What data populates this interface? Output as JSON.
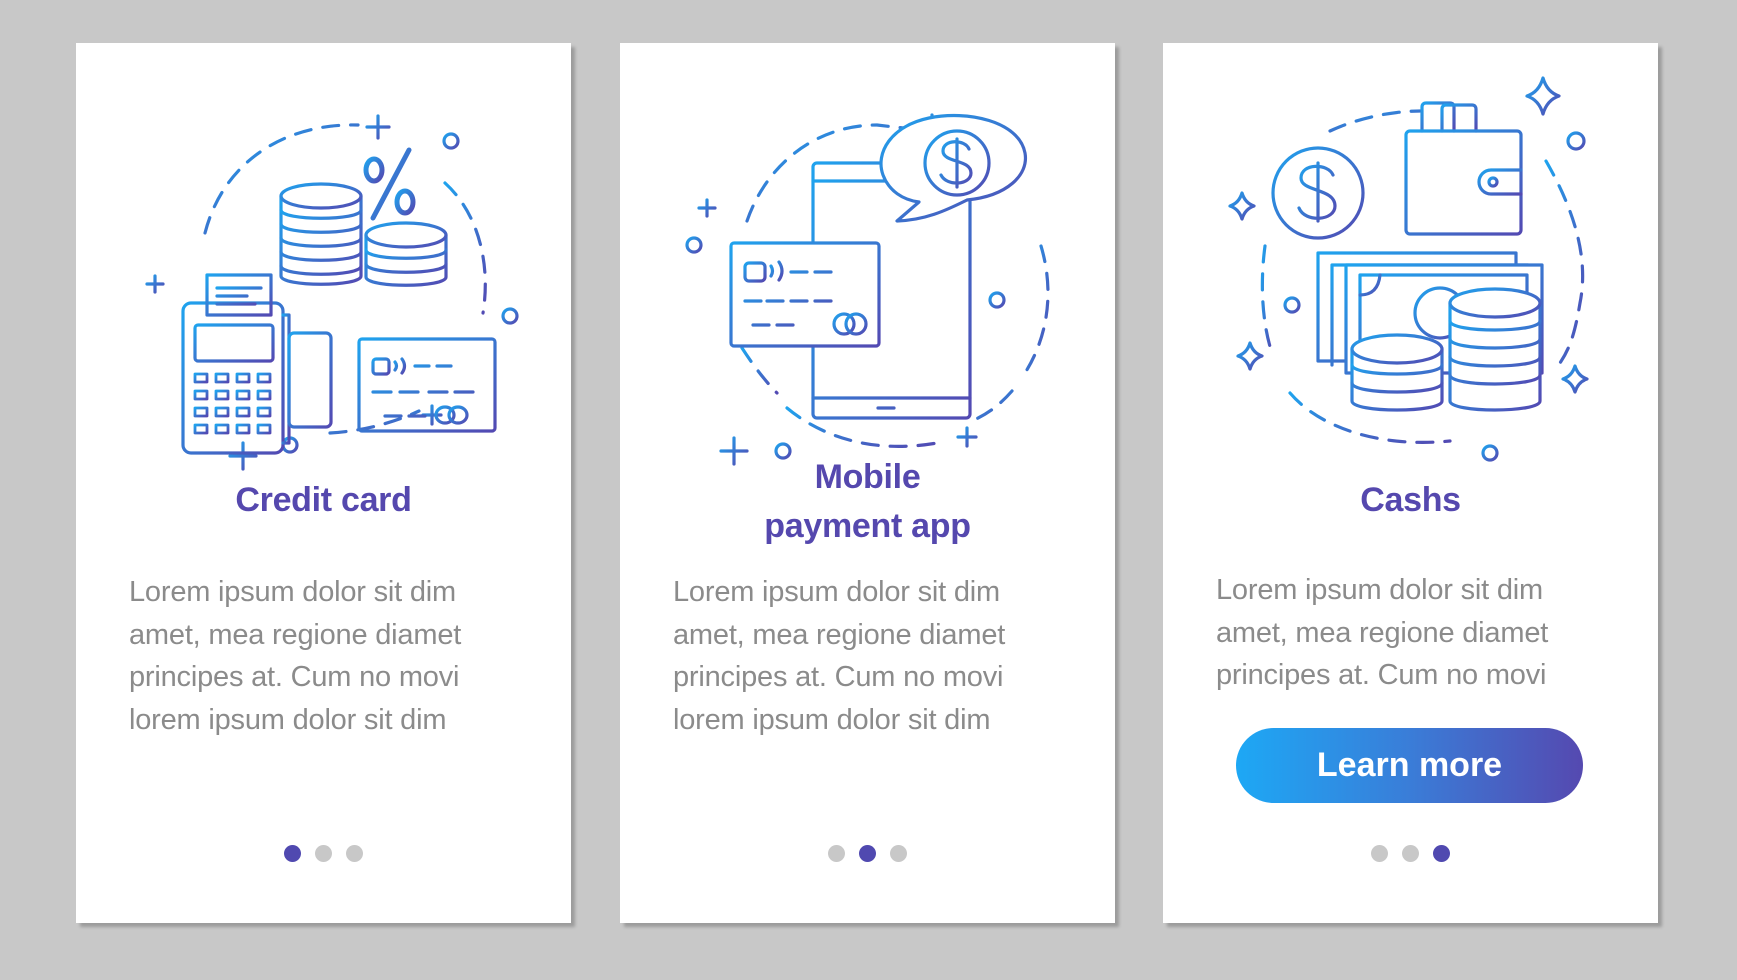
{
  "colors": {
    "background": "#c8c8c8",
    "card": "#ffffff",
    "title": "#5548ae",
    "body_text": "#8b8b8b",
    "accent_start": "#1da8f5",
    "accent_end": "#5549b0",
    "dot_active": "#5049b0",
    "dot_inactive": "#c8c8c8"
  },
  "screens": [
    {
      "title_lines": [
        "Credit card"
      ],
      "body_lines": [
        "Lorem ipsum dolor sit dim",
        "amet, mea regione diamet",
        "principes at. Cum no movi",
        "lorem ipsum dolor sit dim"
      ],
      "illustration": [
        "pos-terminal-icon",
        "coin-stack-icon",
        "percent-icon",
        "credit-card-icon"
      ],
      "pagination": {
        "total": 3,
        "active": 1
      }
    },
    {
      "title_lines": [
        "Mobile",
        "payment app"
      ],
      "body_lines": [
        "Lorem ipsum dolor sit dim",
        "amet, mea regione diamet",
        "principes at. Cum no movi",
        "lorem ipsum dolor sit dim"
      ],
      "illustration": [
        "smartphone-icon",
        "dollar-speech-bubble-icon",
        "credit-card-icon"
      ],
      "pagination": {
        "total": 3,
        "active": 2
      }
    },
    {
      "title_lines": [
        "Cashs"
      ],
      "body_lines": [
        "Lorem ipsum dolor sit dim",
        "amet, mea regione diamet",
        "principes at. Cum no movi"
      ],
      "illustration": [
        "dollar-coin-icon",
        "wallet-icon",
        "banknotes-icon",
        "coin-stack-icon",
        "sparkle-icon"
      ],
      "cta_label": "Learn more",
      "pagination": {
        "total": 3,
        "active": 3
      }
    }
  ]
}
